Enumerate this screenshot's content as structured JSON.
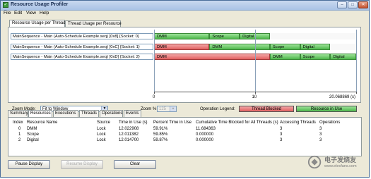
{
  "window": {
    "title": "Resource Usage Profiler"
  },
  "menu": [
    "File",
    "Edit",
    "View",
    "Help"
  ],
  "top_tabs": [
    "Resource Usage per Thread",
    "Thread Usage per Resource"
  ],
  "threads": [
    {
      "label": "MainSequence - Main (Auto-Schedule Example.seq) [0x8] {Socket: 0}",
      "segments": [
        {
          "name": "DMM",
          "state": "use",
          "start": 0.0,
          "end": 5.5
        },
        {
          "name": "Scope",
          "state": "use",
          "start": 5.5,
          "end": 8.5
        },
        {
          "name": "Digital",
          "state": "use",
          "start": 8.5,
          "end": 11.5
        }
      ]
    },
    {
      "label": "MainSequence - Main (Auto-Schedule Example.seq) [0xC] {Socket: 1}",
      "segments": [
        {
          "name": "DMM",
          "state": "blocked",
          "start": 0.0,
          "end": 5.5
        },
        {
          "name": "DMM",
          "state": "use",
          "start": 5.5,
          "end": 11.5
        },
        {
          "name": "Scope",
          "state": "use",
          "start": 11.5,
          "end": 14.5
        },
        {
          "name": "Digital",
          "state": "use",
          "start": 14.5,
          "end": 17.5
        }
      ]
    },
    {
      "label": "MainSequence - Main (Auto-Schedule Example.seq) [0xD] {Socket: 2}",
      "segments": [
        {
          "name": "DMM",
          "state": "blocked",
          "start": 0.0,
          "end": 11.5
        },
        {
          "name": "DMM",
          "state": "use",
          "start": 11.5,
          "end": 14.5
        },
        {
          "name": "Scope",
          "state": "use",
          "start": 14.5,
          "end": 17.5
        },
        {
          "name": "Digital",
          "state": "use",
          "start": 17.5,
          "end": 20.068869
        }
      ]
    }
  ],
  "axis": {
    "ticks": [
      "0",
      "10",
      "20.068869 (s)"
    ],
    "min": 0,
    "max": 20.068869
  },
  "controls": {
    "zoom_mode_label": "Zoom Mode:",
    "zoom_mode_value": "Fit to Window",
    "zoom_pct_label": "Zoom %:",
    "zoom_pct_value": "125",
    "legend_label": "Operation Legend:",
    "legend_blocked": "Thread Blocked",
    "legend_use": "Resource in Use"
  },
  "colors": {
    "use": "#4db64a",
    "blocked": "#e05f5f"
  },
  "bottom_tabs": [
    "Summary",
    "Resources",
    "Executions",
    "Threads",
    "Operations",
    "Events"
  ],
  "table": {
    "headers": [
      "Index",
      "Resource Name",
      "Source",
      "Time in Use (s)",
      "Percent Time in Use",
      "Cumulative Time Blocked for All Threads (s)",
      "Accessing Threads",
      "Operations"
    ],
    "rows": [
      [
        "0",
        "DMM",
        "Lock",
        "12.022908",
        "59.91%",
        "11.684363",
        "3",
        "3"
      ],
      [
        "1",
        "Scope",
        "Lock",
        "12.011382",
        "59.85%",
        "0.000000",
        "3",
        "3"
      ],
      [
        "2",
        "Digital",
        "Lock",
        "12.014700",
        "59.87%",
        "0.000000",
        "3",
        "3"
      ]
    ]
  },
  "buttons": {
    "pause": "Pause Display",
    "resume": "Resume Display",
    "clear": "Clear"
  },
  "watermark": {
    "text": "电子发烧友",
    "url": "www.elecfans.com"
  }
}
